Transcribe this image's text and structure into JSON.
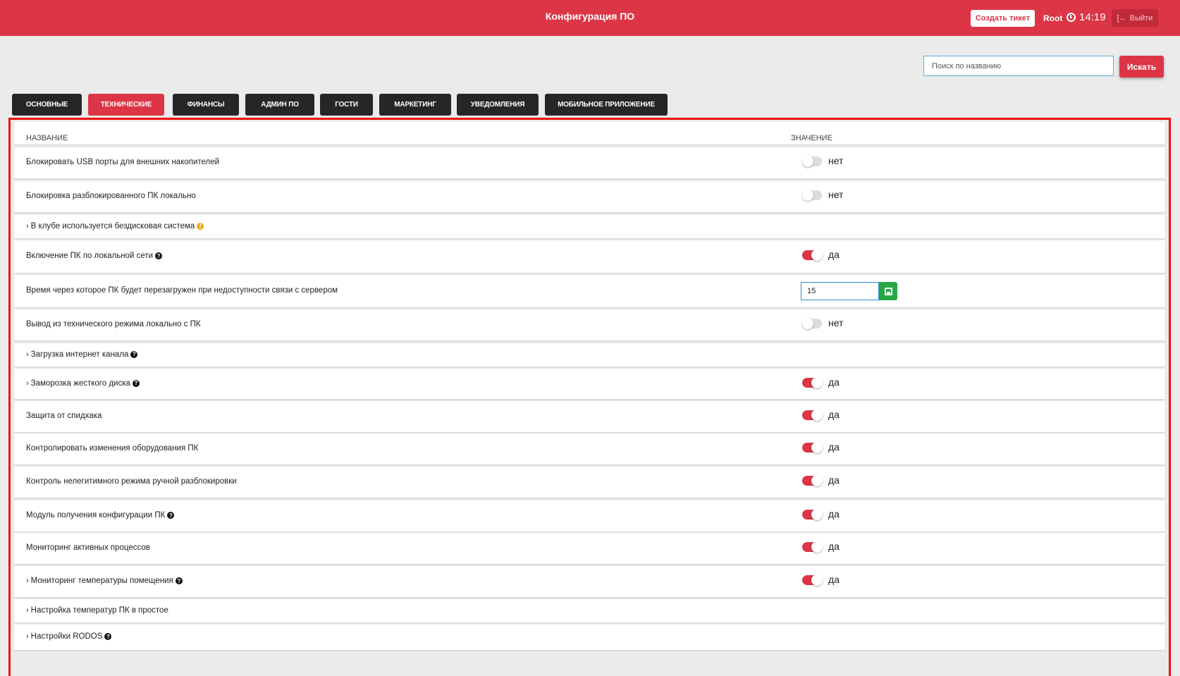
{
  "header": {
    "title": "Конфигурация ПО",
    "ticket_button": "Создать тикет",
    "user": "Root",
    "time": "14:19",
    "logout_button": "Выйти",
    "accent_color": "#dc3545"
  },
  "search": {
    "placeholder": "Поиск по названию",
    "button": "Искать"
  },
  "tabs": [
    {
      "label": "ОСНОВНЫЕ",
      "active": false
    },
    {
      "label": "ТЕХНИЧЕСКИЕ",
      "active": true
    },
    {
      "label": "ФИНАНСЫ",
      "active": false
    },
    {
      "label": "АДМИН ПО",
      "active": false
    },
    {
      "label": "ГОСТИ",
      "active": false
    },
    {
      "label": "МАРКЕТИНГ",
      "active": false
    },
    {
      "label": "УВЕДОМЛЕНИЯ",
      "active": false
    },
    {
      "label": "МОБИЛЬНОЕ ПРИЛОЖЕНИЕ",
      "active": false
    }
  ],
  "table": {
    "columns": {
      "name": "НАЗВАНИЕ",
      "value": "ЗНАЧЕНИЕ"
    },
    "rows": [
      {
        "label": "Блокировать USB порты для внешних накопителей",
        "type": "toggle",
        "on": false,
        "value_text": "нет"
      },
      {
        "label": "Блокировка разблокированного ПК локально",
        "type": "toggle",
        "on": false,
        "value_text": "нет"
      },
      {
        "label": "В клубе используется бездисковая система",
        "type": "group",
        "icon": "warning"
      },
      {
        "label": "Включение ПК по локальной сети",
        "type": "toggle",
        "on": true,
        "value_text": "да",
        "icon": "help"
      },
      {
        "label": "Время через которое ПК будет перезагружен при недоступности связи с сервером",
        "type": "number",
        "value": "15"
      },
      {
        "label": "Вывод из технического режима локально с ПК",
        "type": "toggle",
        "on": false,
        "value_text": "нет"
      },
      {
        "label": "Загрузка интернет канала",
        "type": "group",
        "icon": "help"
      },
      {
        "label": "Заморозка жесткого диска",
        "type": "group-toggle",
        "on": true,
        "value_text": "да",
        "icon": "help"
      },
      {
        "label": "Защита от спидхака",
        "type": "toggle",
        "on": true,
        "value_text": "да"
      },
      {
        "label": "Контролировать изменения оборудования ПК",
        "type": "toggle",
        "on": true,
        "value_text": "да"
      },
      {
        "label": "Контроль нелегитимного режима ручной разблокировки",
        "type": "toggle",
        "on": true,
        "value_text": "да"
      },
      {
        "label": "Модуль получения конфигурации ПК",
        "type": "toggle",
        "on": true,
        "value_text": "да",
        "icon": "help"
      },
      {
        "label": "Мониторинг активных процессов",
        "type": "toggle",
        "on": true,
        "value_text": "да"
      },
      {
        "label": "Мониторинг температуры помещения",
        "type": "group-toggle",
        "on": true,
        "value_text": "да",
        "icon": "help"
      },
      {
        "label": "Настройка температур ПК в простое",
        "type": "group"
      },
      {
        "label": "Настройки RODOS",
        "type": "group",
        "icon": "help"
      }
    ]
  }
}
